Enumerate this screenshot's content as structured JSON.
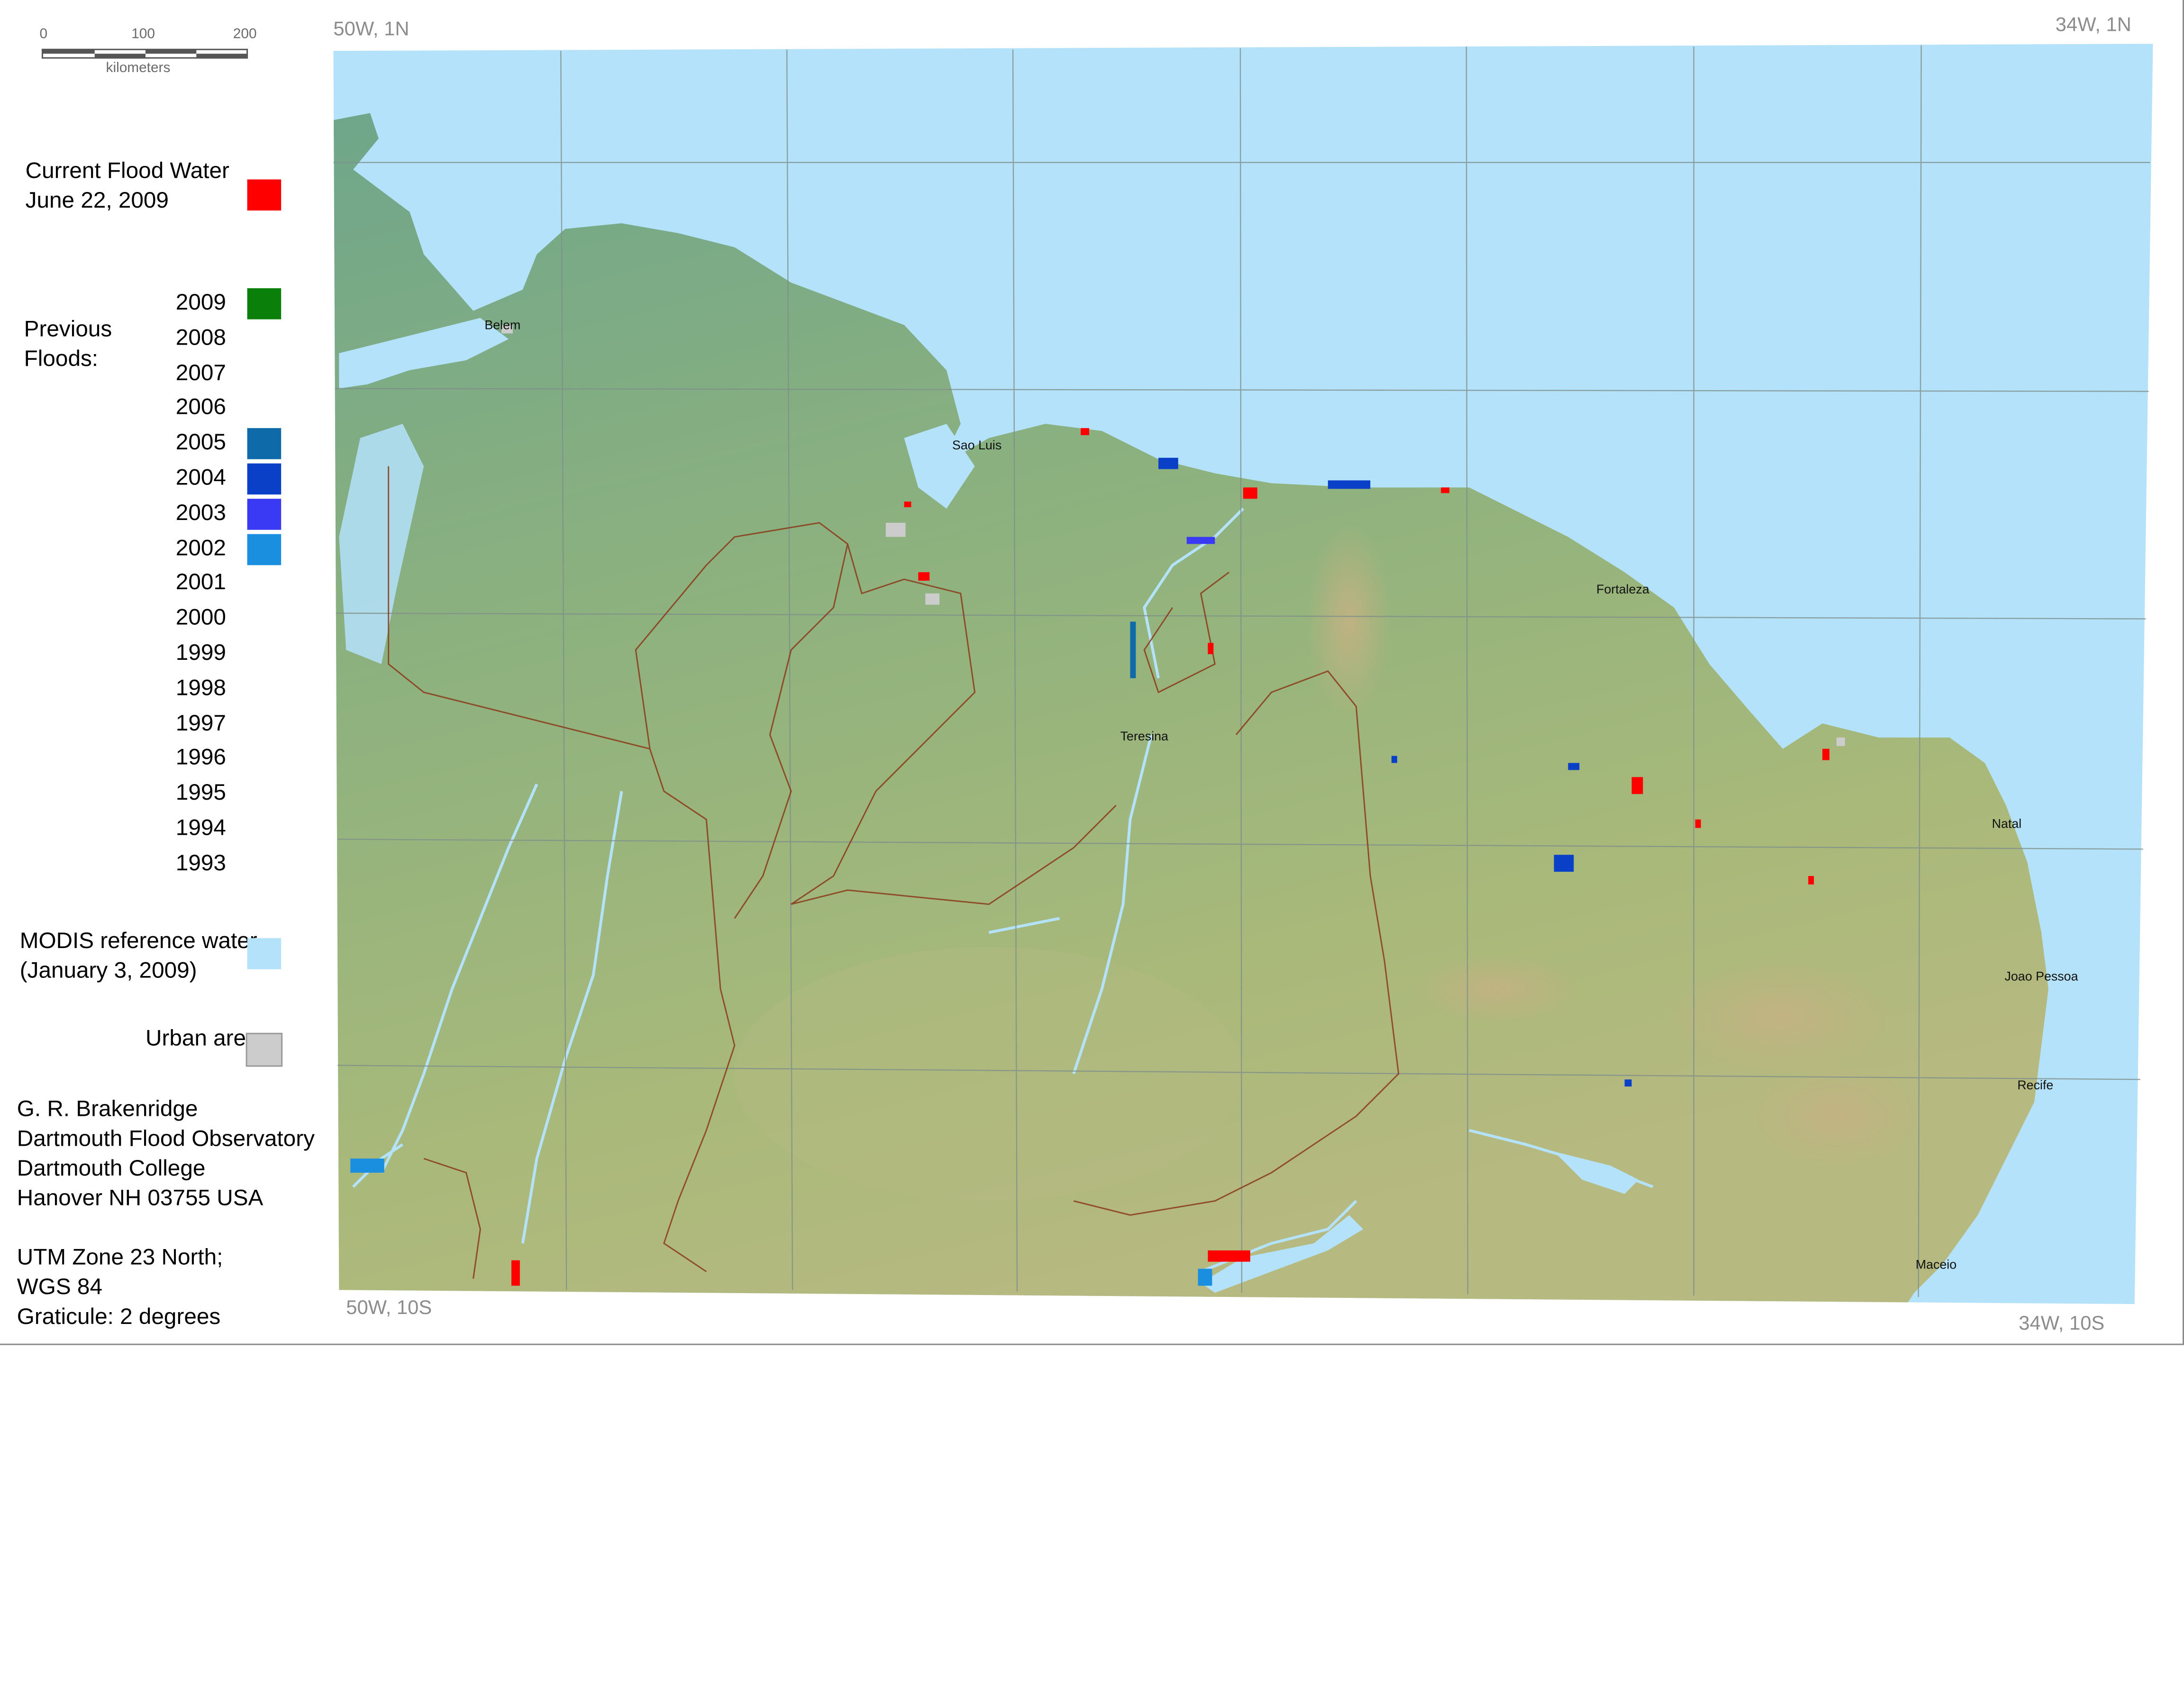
{
  "scale_bar": {
    "ticks": [
      "0",
      "100",
      "200"
    ],
    "unit": "kilometers"
  },
  "legend": {
    "current_flood": {
      "title": "Current Flood Water",
      "date": "June 22, 2009",
      "color": "#ff0000"
    },
    "previous_floods": {
      "title_line1": "Previous",
      "title_line2": "Floods:",
      "years": [
        {
          "year": "2009",
          "color": "#0a7f0a"
        },
        {
          "year": "2008",
          "color": null
        },
        {
          "year": "2007",
          "color": null
        },
        {
          "year": "2006",
          "color": null
        },
        {
          "year": "2005",
          "color": "#0e6aa8"
        },
        {
          "year": "2004",
          "color": "#0a3fc8"
        },
        {
          "year": "2003",
          "color": "#3a3af5"
        },
        {
          "year": "2002",
          "color": "#1a8fe0"
        },
        {
          "year": "2001",
          "color": null
        },
        {
          "year": "2000",
          "color": null
        },
        {
          "year": "1999",
          "color": null
        },
        {
          "year": "1998",
          "color": null
        },
        {
          "year": "1997",
          "color": null
        },
        {
          "year": "1996",
          "color": null
        },
        {
          "year": "1995",
          "color": null
        },
        {
          "year": "1994",
          "color": null
        },
        {
          "year": "1993",
          "color": null
        }
      ]
    },
    "reference_water": {
      "line1": "MODIS reference water",
      "line2": "(January 3, 2009)",
      "color": "#b4e2fb"
    },
    "urban": {
      "label": "Urban areas",
      "color": "#cccccc"
    }
  },
  "credits": {
    "lines": [
      "G. R. Brakenridge",
      "Dartmouth Flood Observatory",
      "Dartmouth College",
      "Hanover NH 03755 USA"
    ]
  },
  "projection": {
    "lines": [
      "UTM Zone 23 North;",
      "WGS 84",
      "Graticule:  2 degrees"
    ]
  },
  "map": {
    "corners": {
      "top_left": "50W, 1N",
      "top_right": "34W, 1N",
      "bottom_left": "50W, 10S",
      "bottom_right": "34W, 10S"
    },
    "cities": [
      {
        "name": "Belem"
      },
      {
        "name": "Sao Luis"
      },
      {
        "name": "Fortaleza"
      },
      {
        "name": "Teresina"
      },
      {
        "name": "Natal"
      },
      {
        "name": "Joao Pessoa"
      },
      {
        "name": "Recife"
      },
      {
        "name": "Maceio"
      }
    ],
    "colors": {
      "ocean": "#b4e2fb",
      "land_low": "#6fa68a",
      "land_high": "#c4b283",
      "graticule": "#7f8f8a",
      "state_border": "#8b3a1a",
      "river": "#b4e2fb"
    }
  }
}
